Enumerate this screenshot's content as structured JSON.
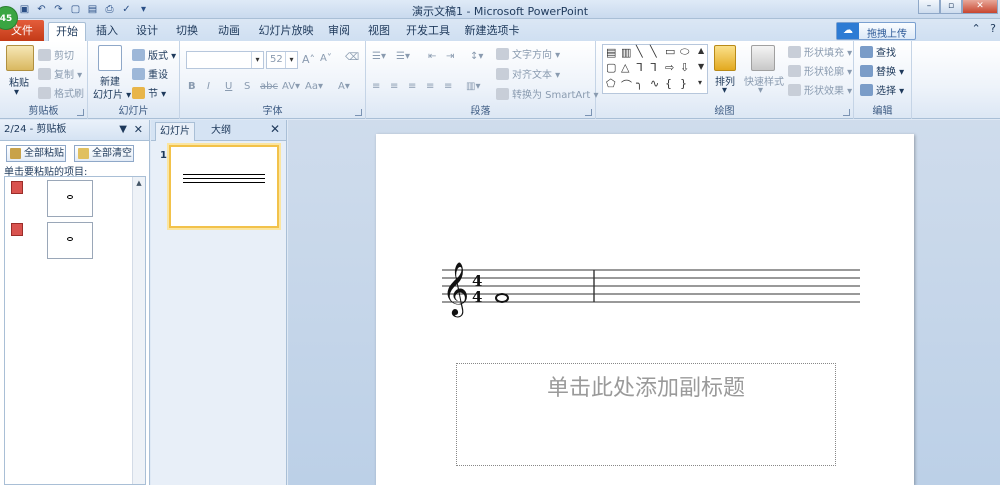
{
  "titlebar": {
    "title": "演示文稿1 - Microsoft PowerPoint",
    "badge": "45"
  },
  "tabs": {
    "file": "文件",
    "items": [
      "开始",
      "插入",
      "设计",
      "切换",
      "动画",
      "幻灯片放映",
      "审阅",
      "视图",
      "开发工具",
      "新建选项卡"
    ],
    "active": "开始",
    "upload": "拖拽上传"
  },
  "ribbon": {
    "clipboard": {
      "label": "剪贴板",
      "paste": "粘贴",
      "cut": "剪切",
      "copy": "复制",
      "format_painter": "格式刷"
    },
    "slides": {
      "label": "幻灯片",
      "new_slide_1": "新建",
      "new_slide_2": "幻灯片",
      "layout": "版式",
      "reset": "重设",
      "section": "节"
    },
    "font": {
      "label": "字体",
      "font_name": "",
      "font_size": "52"
    },
    "paragraph": {
      "label": "段落",
      "text_direction": "文字方向",
      "align_text": "对齐文本",
      "smartart": "转换为 SmartArt"
    },
    "drawing": {
      "label": "绘图",
      "arrange": "排列",
      "quick_styles": "快速样式",
      "shape_fill": "形状填充",
      "shape_outline": "形状轮廓",
      "shape_effects": "形状效果"
    },
    "editing": {
      "label": "编辑",
      "find": "查找",
      "replace": "替换",
      "select": "选择"
    }
  },
  "clipboard_pane": {
    "header": "2/24 - 剪贴板",
    "paste_all": "全部粘贴",
    "clear_all": "全部清空",
    "instruction": "单击要粘贴的项目:"
  },
  "slides_pane": {
    "tab_slides": "幻灯片",
    "tab_outline": "大纲",
    "slide_number": "1"
  },
  "slide": {
    "time_sig_top": "4",
    "time_sig_bottom": "4",
    "subtitle_placeholder": "单击此处添加副标题"
  }
}
